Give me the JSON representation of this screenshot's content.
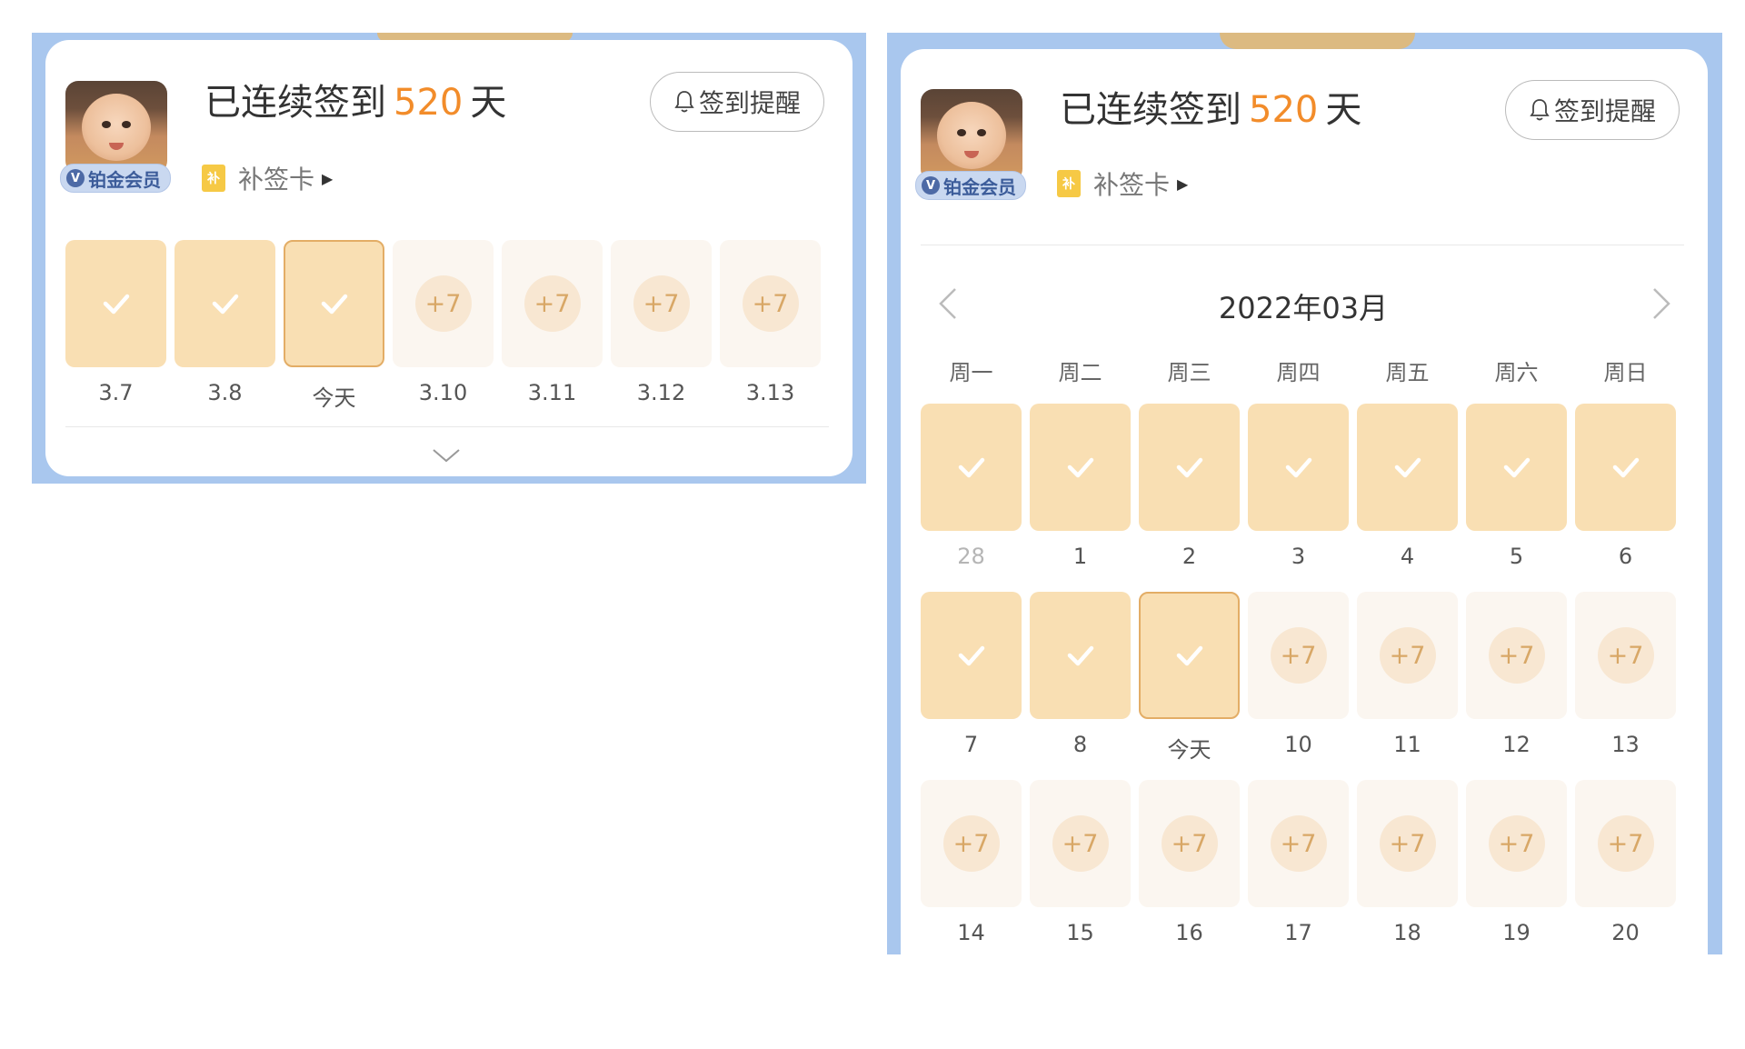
{
  "streak": {
    "prefix": "已连续签到",
    "count": "520",
    "suffix": "天"
  },
  "remind_label": "签到提醒",
  "makeup_label": "补签卡",
  "makeup_icon_text": "补",
  "vip_badge": "铂金会员",
  "vip_icon_text": "V",
  "week_strip": [
    {
      "label": "3.7",
      "state": "done"
    },
    {
      "label": "3.8",
      "state": "done"
    },
    {
      "label": "今天",
      "state": "today"
    },
    {
      "label": "3.10",
      "state": "future",
      "bonus": "+7"
    },
    {
      "label": "3.11",
      "state": "future",
      "bonus": "+7"
    },
    {
      "label": "3.12",
      "state": "future",
      "bonus": "+7"
    },
    {
      "label": "3.13",
      "state": "future",
      "bonus": "+7"
    }
  ],
  "calendar": {
    "month_title": "2022年03月",
    "weekdays": [
      "周一",
      "周二",
      "周三",
      "周四",
      "周五",
      "周六",
      "周日"
    ],
    "rows": [
      [
        {
          "label": "28",
          "state": "done",
          "muted": true
        },
        {
          "label": "1",
          "state": "done"
        },
        {
          "label": "2",
          "state": "done"
        },
        {
          "label": "3",
          "state": "done"
        },
        {
          "label": "4",
          "state": "done"
        },
        {
          "label": "5",
          "state": "done"
        },
        {
          "label": "6",
          "state": "done"
        }
      ],
      [
        {
          "label": "7",
          "state": "done"
        },
        {
          "label": "8",
          "state": "done"
        },
        {
          "label": "今天",
          "state": "today"
        },
        {
          "label": "10",
          "state": "future",
          "bonus": "+7"
        },
        {
          "label": "11",
          "state": "future",
          "bonus": "+7"
        },
        {
          "label": "12",
          "state": "future",
          "bonus": "+7"
        },
        {
          "label": "13",
          "state": "future",
          "bonus": "+7"
        }
      ],
      [
        {
          "label": "14",
          "state": "future",
          "bonus": "+7"
        },
        {
          "label": "15",
          "state": "future",
          "bonus": "+7"
        },
        {
          "label": "16",
          "state": "future",
          "bonus": "+7"
        },
        {
          "label": "17",
          "state": "future",
          "bonus": "+7"
        },
        {
          "label": "18",
          "state": "future",
          "bonus": "+7"
        },
        {
          "label": "19",
          "state": "future",
          "bonus": "+7"
        },
        {
          "label": "20",
          "state": "future",
          "bonus": "+7"
        }
      ]
    ]
  },
  "colors": {
    "accent": "#f28c2a",
    "done_tile": "#f9dfb3",
    "future_tile": "#fbf6f0",
    "panel_bg": "#a9c7ee"
  }
}
